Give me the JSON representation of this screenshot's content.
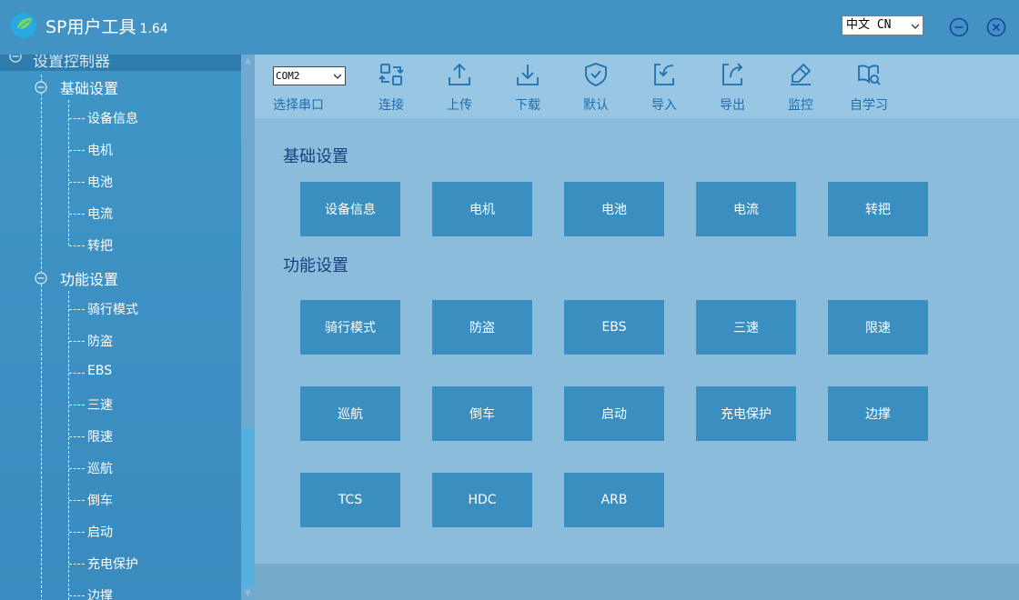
{
  "app": {
    "title": "SP用户工具",
    "version": "1.64"
  },
  "language": {
    "selected": "中文 CN"
  },
  "sidebar": {
    "root_label": "设置控制器",
    "groups": [
      {
        "label": "基础设置",
        "items": [
          "设备信息",
          "电机",
          "电池",
          "电流",
          "转把"
        ]
      },
      {
        "label": "功能设置",
        "items": [
          "骑行模式",
          "防盗",
          "EBS",
          "三速",
          "限速",
          "巡航",
          "倒车",
          "启动",
          "充电保护",
          "边撑"
        ]
      }
    ]
  },
  "toolbar": {
    "port_value": "COM2",
    "port_label": "选择串口",
    "tools": [
      {
        "label": "连接",
        "icon": "connect-icon"
      },
      {
        "label": "上传",
        "icon": "upload-icon"
      },
      {
        "label": "下载",
        "icon": "download-icon"
      },
      {
        "label": "默认",
        "icon": "shield-check-icon"
      },
      {
        "label": "导入",
        "icon": "import-icon"
      },
      {
        "label": "导出",
        "icon": "export-icon"
      },
      {
        "label": "监控",
        "icon": "monitor-icon"
      },
      {
        "label": "自学习",
        "icon": "self-learn-icon"
      }
    ]
  },
  "main": {
    "basic_title": "基础设置",
    "basic_tiles": [
      "设备信息",
      "电机",
      "电池",
      "电流",
      "转把"
    ],
    "function_title": "功能设置",
    "function_tiles": [
      "骑行模式",
      "防盗",
      "EBS",
      "三速",
      "限速",
      "巡航",
      "倒车",
      "启动",
      "充电保护",
      "边撑",
      "TCS",
      "HDC",
      "ARB"
    ]
  },
  "colors": {
    "titlebar": "#4293c4",
    "sidebar": "#3f95c6",
    "toolbar": "#98c6e3",
    "panel": "#8bbcdc",
    "tile": "#3b8ec0",
    "accent": "#1e6fb0"
  }
}
